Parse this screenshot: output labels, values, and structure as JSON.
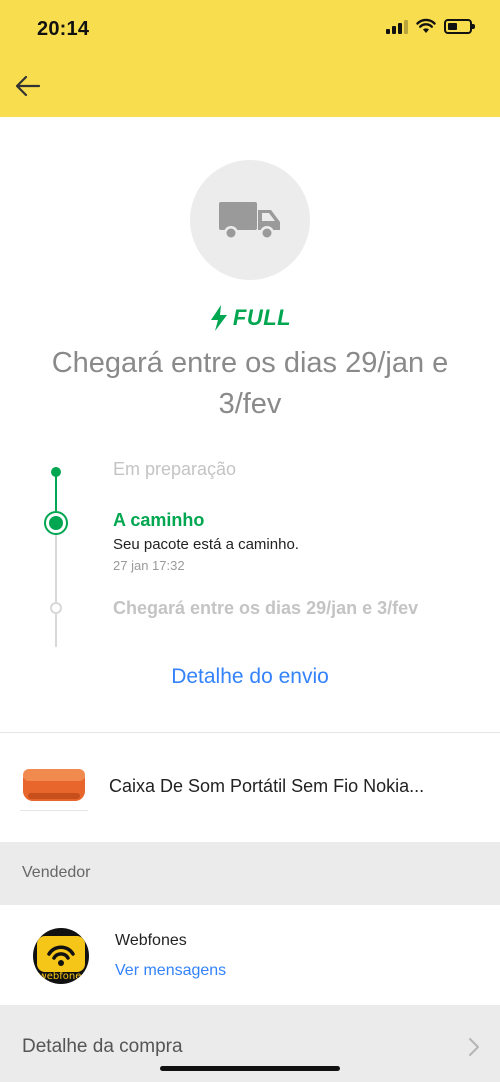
{
  "status_bar": {
    "time": "20:14"
  },
  "header": {
    "back_icon": "arrow-left-icon",
    "background_color": "#f8dd4f"
  },
  "shipment": {
    "icon": "truck-icon",
    "badge": "FULL",
    "badge_icon": "lightning-bolt-icon",
    "badge_color": "#00a650",
    "headline": "Chegará entre os dias 29/jan e 3/fev"
  },
  "timeline": {
    "steps": [
      {
        "label": "Em preparação",
        "state": "done"
      },
      {
        "label": "A caminho",
        "state": "current",
        "description": "Seu pacote está a caminho.",
        "timestamp": "27 jan 17:32"
      },
      {
        "label": "Chegará entre os dias 29/jan e 3/fev",
        "state": "pending"
      }
    ]
  },
  "links": {
    "shipping_detail": "Detalhe do envio",
    "link_color": "#3483fa"
  },
  "product": {
    "name": "Caixa De Som Portátil Sem Fio Nokia..."
  },
  "seller": {
    "section_label": "Vendedor",
    "name": "Webfones",
    "avatar_text": "webfone",
    "messages_link": "Ver mensagens"
  },
  "purchase": {
    "label": "Detalhe da compra",
    "chevron_icon": "chevron-right-icon"
  }
}
